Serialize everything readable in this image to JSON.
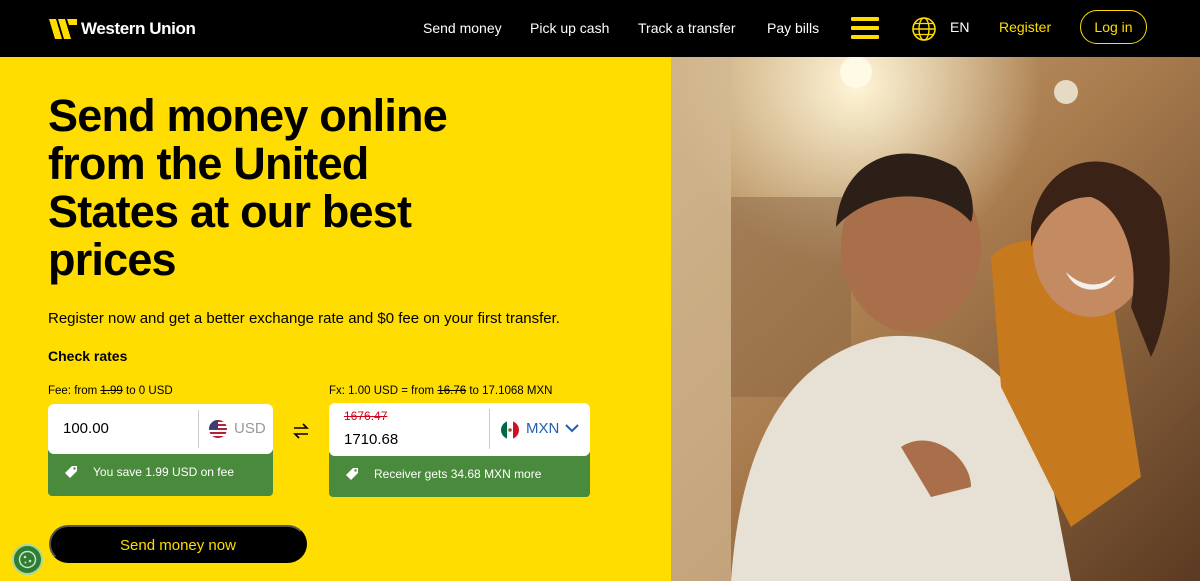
{
  "brand": {
    "name": "Western Union"
  },
  "nav": {
    "links": [
      "Send money",
      "Pick up cash",
      "Track a transfer",
      "Pay bills"
    ],
    "language": "EN",
    "register": "Register",
    "login": "Log in"
  },
  "hero": {
    "title": "Send money online from the United States at our best prices",
    "subtitle": "Register now and get a better exchange rate and $0 fee on your first transfer.",
    "check_rates": "Check rates"
  },
  "fee": {
    "prefix": "Fee: from",
    "old": "1.99",
    "suffix": "to 0 USD"
  },
  "fx": {
    "prefix": "Fx: 1.00 USD = from",
    "old": "16.76",
    "mid": "to",
    "new": "17.1068 MXN"
  },
  "send": {
    "amount": "100.00",
    "currency": "USD",
    "savings": "You save 1.99 USD on fee"
  },
  "receive": {
    "old_amount": "1676.47",
    "amount": "1710.68",
    "currency": "MXN",
    "savings": "Receiver gets 34.68 MXN more"
  },
  "cta": {
    "label": "Send money now"
  },
  "colors": {
    "brand_yellow": "#ffdd00",
    "nav_black": "#000000",
    "save_green": "#4a8a3c",
    "strike_red": "#d0021b"
  },
  "icons": [
    "western-union-logo-icon",
    "menu-icon",
    "globe-icon",
    "us-flag-icon",
    "mexico-flag-icon",
    "chevron-down-icon",
    "swap-icon",
    "tag-icon",
    "cookie-icon"
  ]
}
